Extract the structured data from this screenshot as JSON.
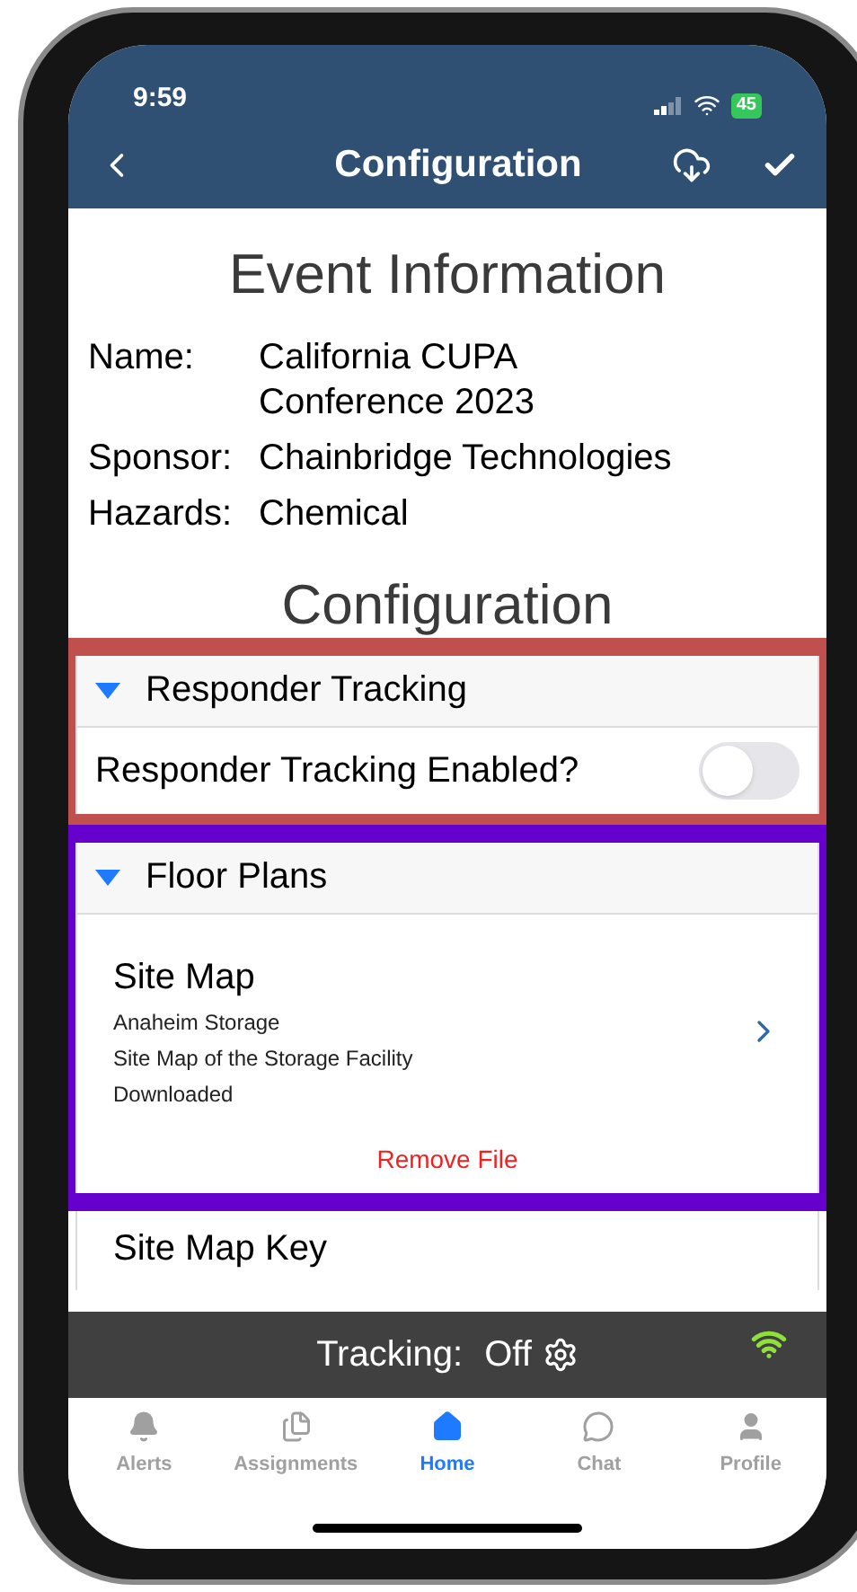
{
  "status_bar": {
    "time": "9:59",
    "battery": "45"
  },
  "nav": {
    "title": "Configuration"
  },
  "event": {
    "heading": "Event Information",
    "fields": [
      {
        "label": "Name:",
        "lines": [
          "California CUPA",
          "Conference 2023"
        ]
      },
      {
        "label": "Sponsor:",
        "lines": [
          "Chainbridge Technologies"
        ]
      },
      {
        "label": "Hazards:",
        "lines": [
          "Chemical"
        ]
      }
    ]
  },
  "config_heading": "Configuration",
  "sections": [
    {
      "title": "Responder Tracking",
      "expanded": true,
      "color": "#c0504d",
      "rows": [
        {
          "kind": "toggle",
          "label": "Responder Tracking Enabled?",
          "on": false
        }
      ]
    },
    {
      "title": "Floor Plans",
      "expanded": true,
      "color": "#6600cc",
      "rows": [
        {
          "kind": "file",
          "title": "Site Map",
          "lines": [
            "Anaheim Storage",
            "Site Map of the Storage Facility",
            "Downloaded"
          ],
          "action": "Remove File"
        }
      ]
    },
    {
      "rows": [
        {
          "kind": "file",
          "title": "Site Map Key",
          "lines": []
        }
      ]
    }
  ],
  "tracking": {
    "label": "Tracking:",
    "value": "Off"
  },
  "tabs": [
    {
      "label": "Alerts",
      "selected": false
    },
    {
      "label": "Assignments",
      "selected": false
    },
    {
      "label": "Home",
      "selected": true
    },
    {
      "label": "Chat",
      "selected": false
    },
    {
      "label": "Profile",
      "selected": false
    }
  ]
}
